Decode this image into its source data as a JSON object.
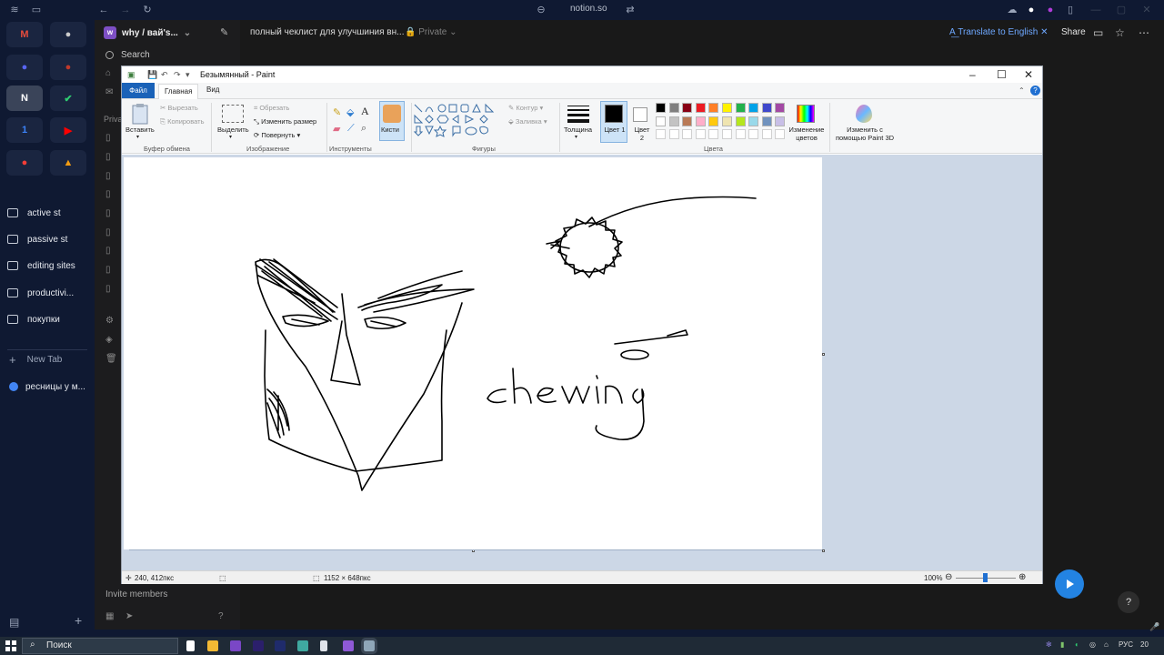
{
  "browser": {
    "url": "notion.so"
  },
  "rail": {
    "tiles": [
      {
        "icon": "gmail-icon",
        "glyph": "M",
        "color": "#e74c3c"
      },
      {
        "icon": "apple-icon",
        "glyph": "●",
        "color": "#cccccc"
      },
      {
        "icon": "discord-icon",
        "glyph": "●",
        "color": "#5865f2"
      },
      {
        "icon": "app-icon",
        "glyph": "●",
        "color": "#c0392b"
      },
      {
        "icon": "notion-icon",
        "glyph": "N",
        "color": "#ffffff"
      },
      {
        "icon": "ticktick-icon",
        "glyph": "✔",
        "color": "#2ecc71"
      },
      {
        "icon": "app1-icon",
        "glyph": "1",
        "color": "#3b82f6"
      },
      {
        "icon": "youtube-icon",
        "glyph": "▶",
        "color": "#ff0000"
      },
      {
        "icon": "pocketcasts-icon",
        "glyph": "●",
        "color": "#f43e37"
      },
      {
        "icon": "image-app-icon",
        "glyph": "▲",
        "color": "#f39c12"
      }
    ],
    "folders": [
      "active st",
      "passive st",
      "editing sites",
      "productivi...",
      "покупки"
    ],
    "new_tab": "New Tab",
    "tab_item": "ресницы у м..."
  },
  "notion": {
    "workspace": "why / вай's...",
    "search": "Search",
    "private_heading": "Priva",
    "breadcrumb": "полный чеклист для улучшиния вн...",
    "privacy": "Private",
    "translate": "Translate to English",
    "share": "Share",
    "invite": "Invite members"
  },
  "paint": {
    "title": "Безымянный - Paint",
    "tabs": {
      "file": "Файл",
      "home": "Главная",
      "view": "Вид"
    },
    "clipboard": {
      "paste": "Вставить",
      "cut": "Вырезать",
      "copy": "Копировать",
      "label": "Буфер обмена"
    },
    "image": {
      "select": "Выделить",
      "crop": "Обрезать",
      "resize": "Изменить размер",
      "rotate": "Повернуть",
      "label": "Изображение"
    },
    "tools": {
      "label": "Инструменты",
      "brushes": "Кисти"
    },
    "shapes": {
      "outline": "Контур",
      "fill": "Заливка",
      "label": "Фигуры"
    },
    "size_label": "Толщина",
    "color1": "Цвет 1",
    "color2": "Цвет 2",
    "edit_colors": "Изменение цветов",
    "paint3d": "Изменить с помощью Paint 3D",
    "colors_label": "Цвета",
    "palette_row1": [
      "#000000",
      "#7f7f7f",
      "#880015",
      "#ed1c24",
      "#ff7f27",
      "#fff200",
      "#22b14c",
      "#00a2e8",
      "#3f48cc",
      "#a349a4"
    ],
    "palette_row2": [
      "#ffffff",
      "#c3c3c3",
      "#b97a57",
      "#ffaec9",
      "#ffc90e",
      "#efe4b0",
      "#b5e61d",
      "#99d9ea",
      "#7092be",
      "#c8bfe7"
    ],
    "canvas_text": "chewing",
    "status": {
      "cursor": "240, 412пкс",
      "size": "1152 × 648пкс",
      "zoom": "100%"
    }
  },
  "taskbar": {
    "search": "Поиск",
    "lang": "РУС",
    "time": "20"
  }
}
